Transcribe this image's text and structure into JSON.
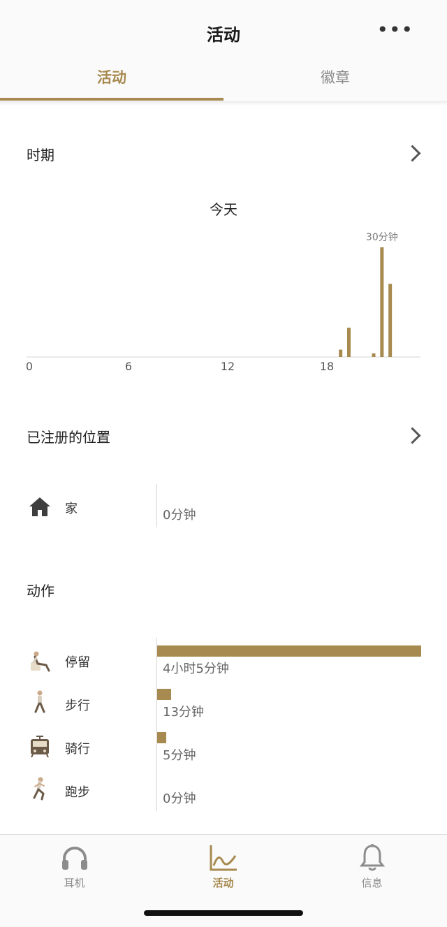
{
  "header": {
    "title": "活动",
    "more": "•••"
  },
  "tabs": [
    {
      "label": "活动",
      "active": true
    },
    {
      "label": "徽章",
      "active": false
    }
  ],
  "period": {
    "title": "时期",
    "chart_title": "今天",
    "chart_data": {
      "type": "bar",
      "x": [
        19,
        19.5,
        21,
        21.5,
        22
      ],
      "values": [
        2,
        8,
        1,
        30,
        20
      ],
      "xlim": [
        0,
        24
      ],
      "ylim": [
        0,
        30
      ],
      "xticks": [
        "0",
        "6",
        "12",
        "18"
      ],
      "data_label": "30分钟",
      "color": "#a78a4f"
    }
  },
  "locations": {
    "title": "已注册的位置",
    "items": [
      {
        "icon": "home-icon",
        "label": "家",
        "value": "0分钟"
      }
    ]
  },
  "actions": {
    "title": "动作",
    "items": [
      {
        "icon": "sitting-icon",
        "label": "停留",
        "value": "4小时5分钟",
        "fraction": 1.0
      },
      {
        "icon": "walking-icon",
        "label": "步行",
        "value": "13分钟",
        "fraction": 0.053
      },
      {
        "icon": "train-icon",
        "label": "骑行",
        "value": "5分钟",
        "fraction": 0.034
      },
      {
        "icon": "running-icon",
        "label": "跑步",
        "value": "0分钟",
        "fraction": 0
      }
    ]
  },
  "nav": [
    {
      "icon": "headphones-icon",
      "label": "耳机",
      "active": false
    },
    {
      "icon": "activity-chart-icon",
      "label": "活动",
      "active": true
    },
    {
      "icon": "bell-icon",
      "label": "信息",
      "active": false
    }
  ],
  "colors": {
    "accent": "#a78a4f",
    "inactive": "#8c8c8c"
  }
}
